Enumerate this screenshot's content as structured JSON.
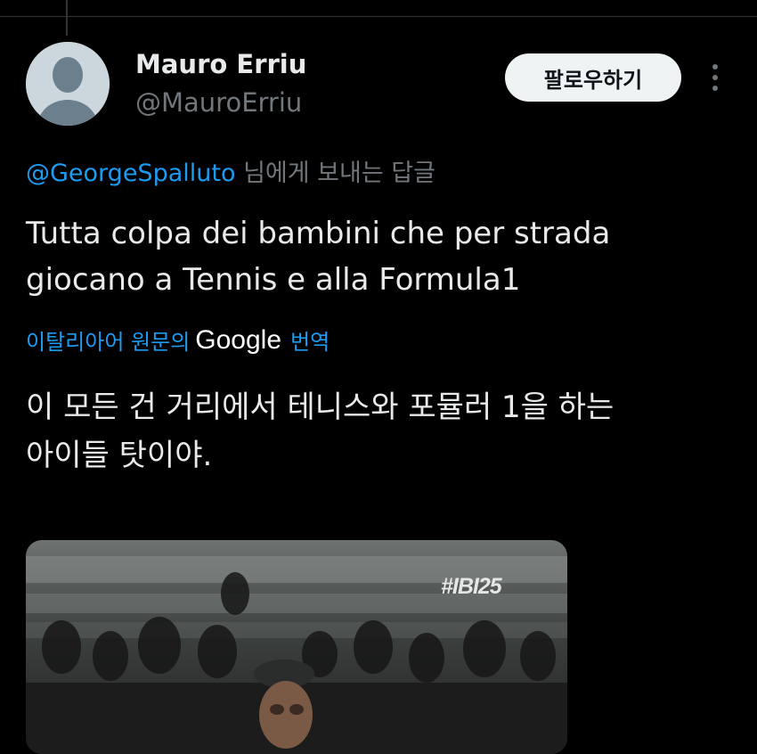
{
  "tweet": {
    "author_name": "Mauro Erriu",
    "author_handle": "@MauroErriu",
    "follow_label": "팔로우하기",
    "reply_mention": "@GeorgeSpalluto",
    "reply_suffix": " 님에게 보내는 답글",
    "text_line1": "Tutta colpa dei bambini che per strada",
    "text_line2": "giocano a Tennis e alla Formula1",
    "translate_prefix": "이탈리아어 원문의",
    "translate_brand": "Google",
    "translate_suffix": "번역",
    "translation_line1": "이 모든 건 거리에서 테니스와 포뮬러 1을 하는",
    "translation_line2": "아이들 탓이야.",
    "media_tag": "#IBI25",
    "icons": {
      "avatar": "default-avatar-icon",
      "more": "more-vertical-icon"
    },
    "colors": {
      "background": "#000000",
      "accent": "#1d9bf0",
      "primary_text": "#e7e9ea",
      "secondary_text": "#71767b",
      "button_bg": "#eff3f4"
    }
  }
}
